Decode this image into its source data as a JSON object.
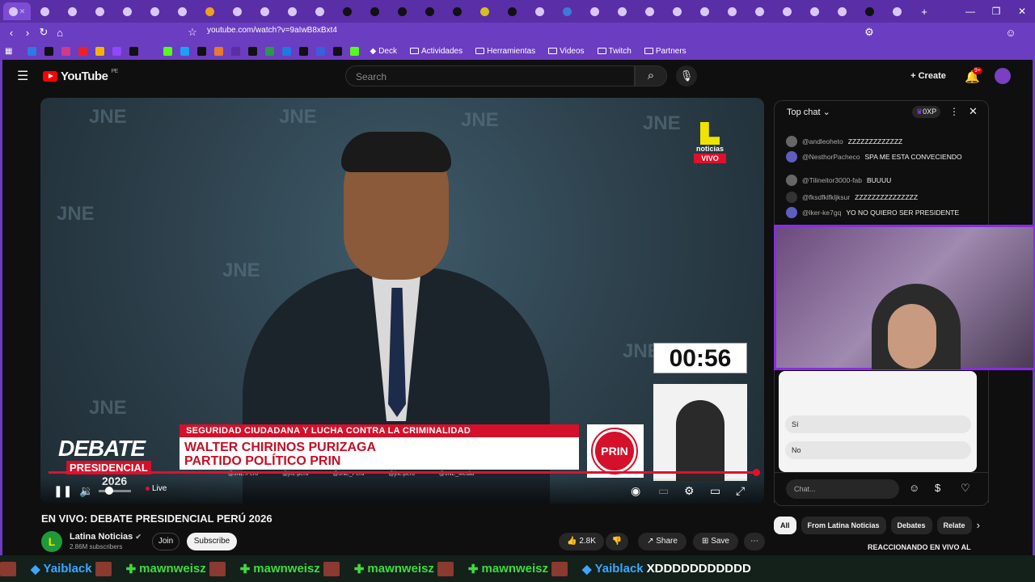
{
  "browser": {
    "url": "youtube.com/watch?v=9aIwB8xBxt4",
    "bookmarks": [
      "Deck",
      "Actividades",
      "Herramientas",
      "Videos",
      "Twitch",
      "Partners"
    ]
  },
  "yt": {
    "logo": "YouTube",
    "region": "PE",
    "search_placeholder": "Search",
    "create": "Create",
    "notif_badge": "9+"
  },
  "video": {
    "watermark": "JNE",
    "channel_logo_text": "noticias",
    "vivo": "VIVO",
    "timer": "00:56",
    "lower_top": "SEGURIDAD CIUDADANA Y LUCHA CONTRA LA CRIMINALIDAD",
    "lower_name1": "WALTER CHIRINOS PURIZAGA",
    "lower_name2": "PARTIDO POLÍTICO PRIN",
    "prin": "PRIN",
    "debate": "DEBATE",
    "presidencial": "PRESIDENCIAL",
    "year": "2026",
    "social": [
      "@JNE.Peru",
      "@jne.peru",
      "@JNE_Peru",
      "@jne.peru",
      "@JNE_Media"
    ],
    "live": "Live"
  },
  "meta": {
    "title": "EN VIVO: DEBATE PRESIDENCIAL PERÚ 2026",
    "channel": "Latina Noticias",
    "subscribers": "2.86M subscribers",
    "join": "Join",
    "subscribe": "Subscribe",
    "likes": "2.8K",
    "share": "Share",
    "save": "Save"
  },
  "chat": {
    "header": "Top chat",
    "points": "0XP",
    "messages": [
      {
        "author": "@andleoheto",
        "text": "ZZZZZZZZZZZZZ"
      },
      {
        "author": "@NesthorPacheco",
        "text": "SPA ME ESTA CONVECIENDO"
      },
      {
        "author": "@Tilineitor3000-fab",
        "text": "BUUUU"
      },
      {
        "author": "@fksdfklfkljksur",
        "text": "ZZZZZZZZZZZZZZZ"
      },
      {
        "author": "@lker-ke7gq",
        "text": "YO NO QUIERO SER PRESIDENTE"
      }
    ],
    "poll_options": [
      "Sí",
      "No"
    ],
    "input_placeholder": "Chat..."
  },
  "chips": [
    "All",
    "From Latina Noticias",
    "Debates",
    "Relate"
  ],
  "recommended": "REACCIONANDO EN VIVO AL",
  "ticker": [
    {
      "name": "Yaiblack",
      "color": "blue"
    },
    {
      "name": "mawnweisz",
      "color": "green"
    },
    {
      "name": "mawnweisz",
      "color": "green"
    },
    {
      "name": "mawnweisz",
      "color": "green"
    },
    {
      "name": "mawnweisz",
      "color": "green"
    },
    {
      "name": "Yaiblack",
      "color": "blue",
      "extra": "XDDDDDDDDDDD"
    }
  ]
}
